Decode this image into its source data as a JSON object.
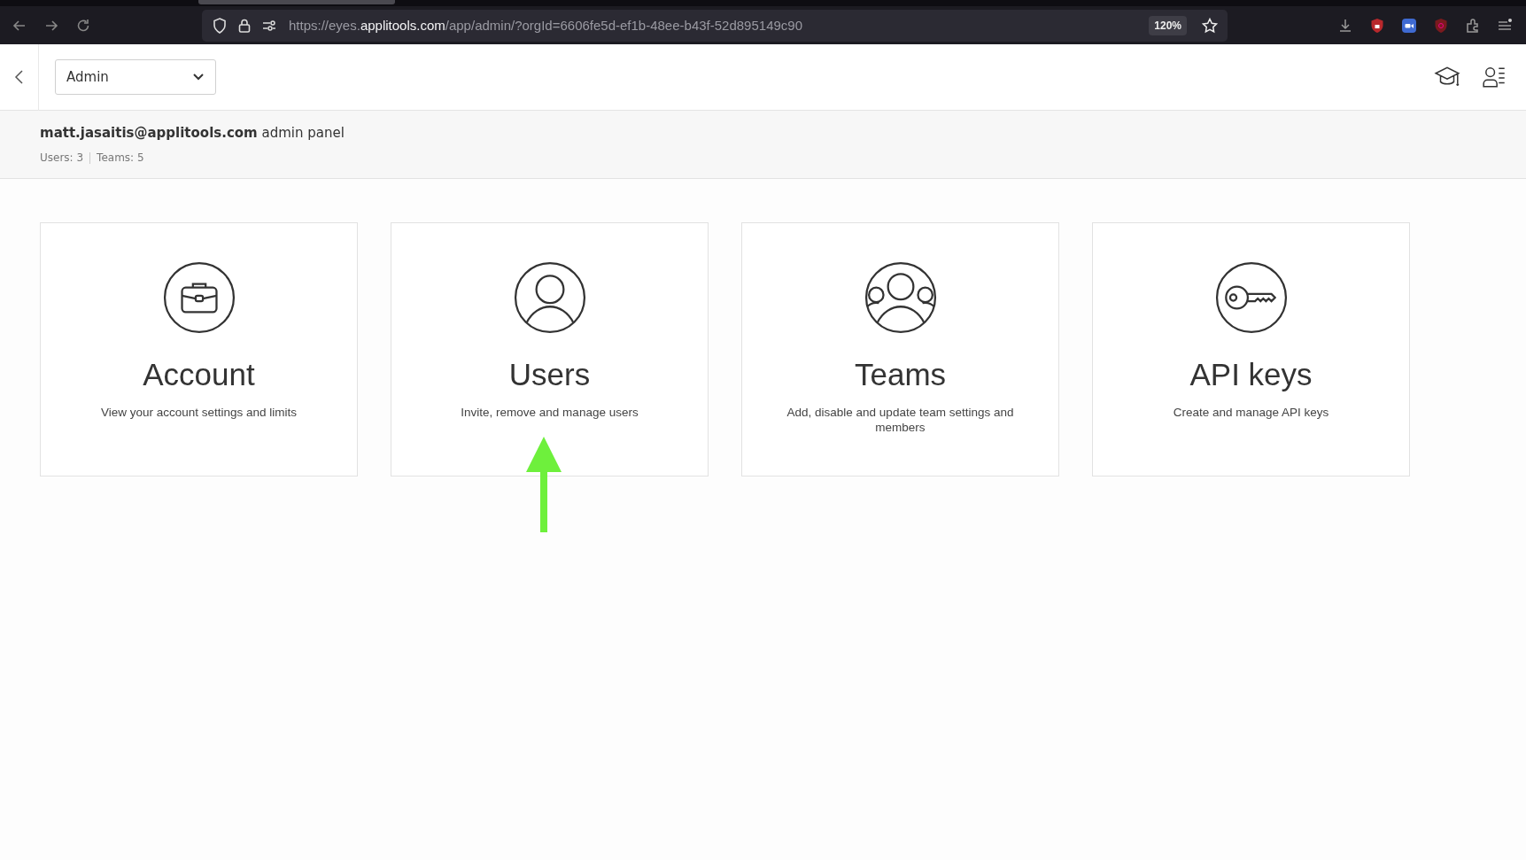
{
  "browser": {
    "url": "https://eyes.**applitools.com**/app/admin/?orgId=6606fe5d-ef1b-48ee-b43f-52d895149c90",
    "zoom": "120%"
  },
  "header": {
    "dropdown": {
      "value": "Admin"
    }
  },
  "panel": {
    "title": "**matt.jasaitis@applitools.com** admin panel",
    "stats": [
      "Users: 3",
      "Teams: 5"
    ]
  },
  "cards": [
    {
      "kind": "account",
      "title": "Account",
      "description": "View your account settings and limits"
    },
    {
      "kind": "users",
      "title": "Users",
      "description": "Invite, remove and manage users"
    },
    {
      "kind": "teams",
      "title": "Teams",
      "description": "Add, disable and update team settings and members"
    },
    {
      "kind": "api_keys",
      "title": "API keys",
      "description": "Create and manage API keys"
    }
  ]
}
